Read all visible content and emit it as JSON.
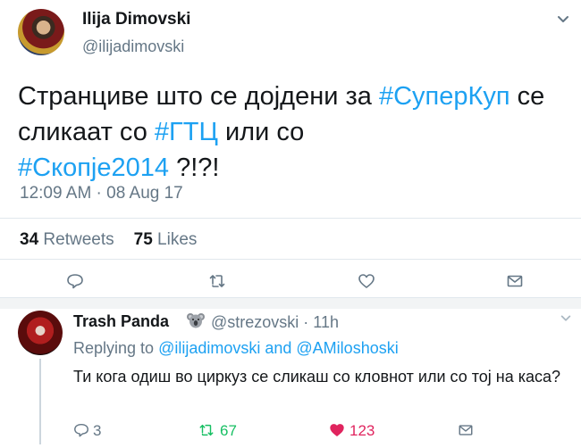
{
  "tweet": {
    "author_name": "Ilija Dimovski",
    "author_handle": "@ilijadimovski",
    "text_parts": {
      "p1": "Странциве што се дојдени за ",
      "h1": "#СуперКуп",
      "p2": " се сликаат со ",
      "h2": "#ГТЦ",
      "p3": " или со ",
      "h3": "#Скопје2014",
      "p4": " ?!?!"
    },
    "timestamp": "12:09 AM · 08 Aug 17",
    "stats": {
      "retweets_count": "34",
      "retweets_label": "Retweets",
      "likes_count": "75",
      "likes_label": "Likes"
    }
  },
  "reply": {
    "author_name": "Trash Panda",
    "handle_time": "@strezovski · 11h",
    "replying_prefix": "Replying to ",
    "mention1": "@ilijadimovski",
    "and": " and ",
    "mention2": "@AMiloshoski",
    "text": "Ти кога одиш во циркуз се сликаш со кловнот или со тој на каса?",
    "counts": {
      "replies": "3",
      "retweets": "67",
      "likes": "123"
    }
  },
  "colors": {
    "accent": "#1da1f2",
    "retweet_green": "#17bf63",
    "like_red": "#e0245e",
    "muted": "#657786"
  }
}
